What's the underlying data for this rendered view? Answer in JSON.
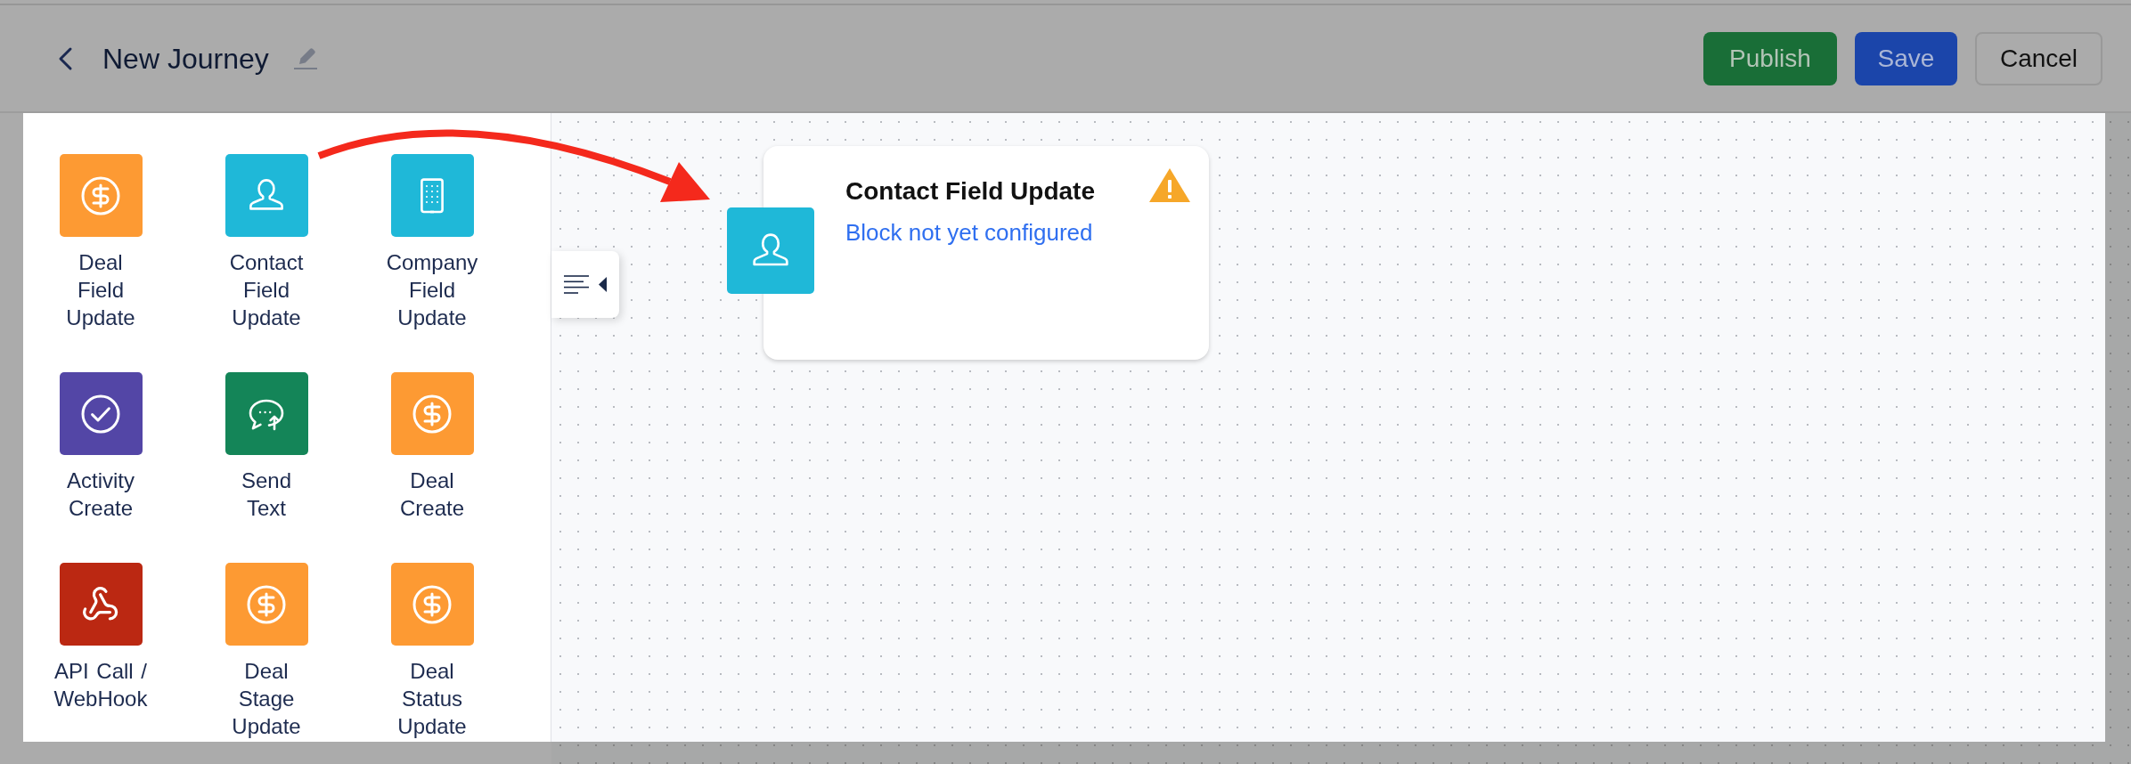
{
  "header": {
    "title": "New Journey",
    "buttons": [
      {
        "label": "Publish",
        "kind": "success"
      },
      {
        "label": "Save",
        "kind": "primary"
      },
      {
        "label": "Cancel",
        "kind": "outline"
      }
    ]
  },
  "palette": [
    {
      "label": "Deal Field Update",
      "kind": "deal",
      "color": "#fd9a33"
    },
    {
      "label": "Contact Field Update",
      "kind": "contact",
      "color": "#1fb8d8"
    },
    {
      "label": "Company Field Update",
      "kind": "company",
      "color": "#1fb8d8"
    },
    {
      "label": "Activity Create",
      "kind": "activity",
      "color": "#5346a6"
    },
    {
      "label": "Send Text",
      "kind": "text",
      "color": "#148558"
    },
    {
      "label": "Deal Create",
      "kind": "deal",
      "color": "#fd9a33"
    },
    {
      "label": "API Call / WebHook",
      "kind": "webhook",
      "color": "#bb2812"
    },
    {
      "label": "Deal Stage Update",
      "kind": "deal",
      "color": "#fd9a33"
    },
    {
      "label": "Deal Status Update",
      "kind": "deal",
      "color": "#fd9a33"
    }
  ],
  "canvas": {
    "nodes": [
      {
        "kind": "contact",
        "color": "#1fb8d8",
        "title": "Contact Field Update",
        "status": "Block not yet configured",
        "warning": true
      }
    ]
  }
}
